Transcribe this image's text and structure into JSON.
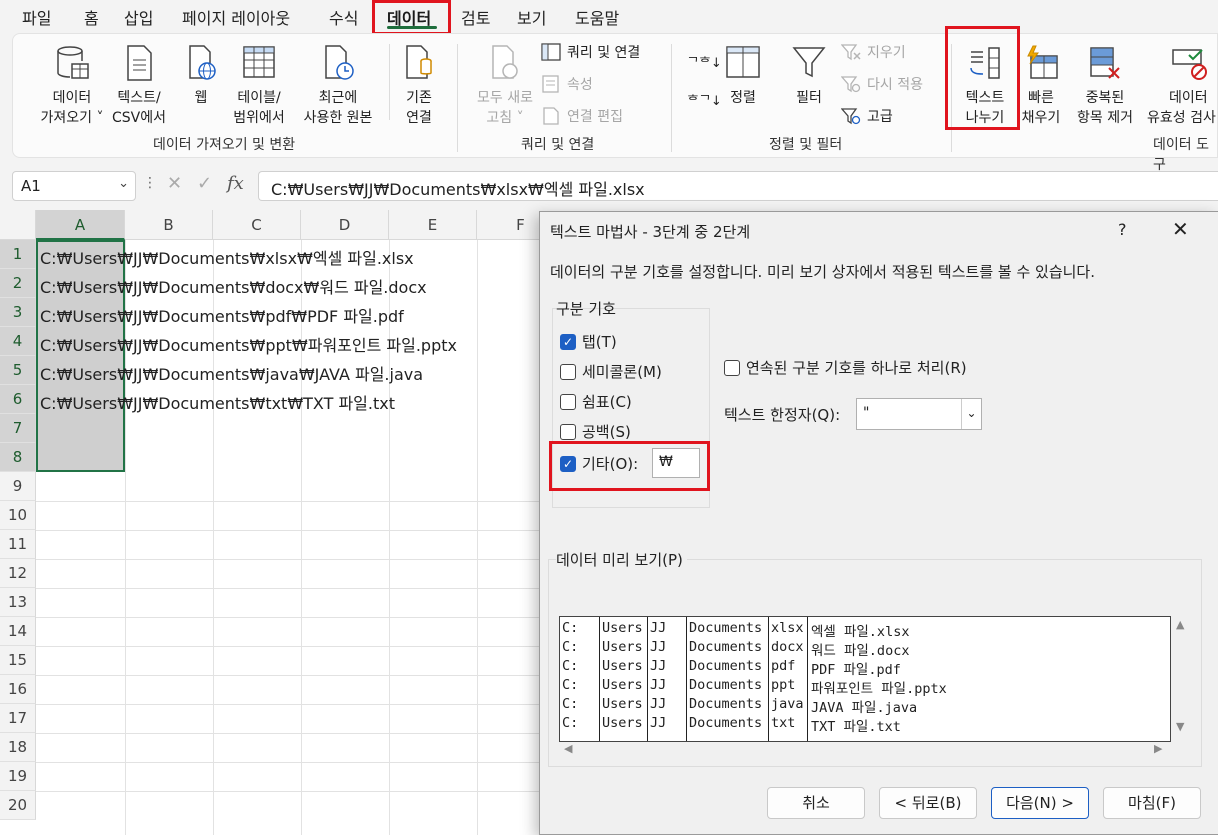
{
  "menu": {
    "tabs": [
      "파일",
      "홈",
      "삽입",
      "페이지 레이아웃",
      "수식",
      "데이터",
      "검토",
      "보기",
      "도움말"
    ],
    "active_tab": "데이터"
  },
  "ribbon": {
    "get_data": {
      "line1": "데이터",
      "line2": "가져오기 ˅"
    },
    "from_text_csv": {
      "line1": "텍스트/",
      "line2": "CSV에서"
    },
    "web": {
      "line1": "웹"
    },
    "table_range": {
      "line1": "테이블/",
      "line2": "범위에서"
    },
    "recent_sources": {
      "line1": "최근에",
      "line2": "사용한 원본"
    },
    "existing_conn": {
      "line1": "기존",
      "line2": "연결"
    },
    "group_get_transform": "데이터 가져오기 및 변환",
    "refresh_all": {
      "line1": "모두 새로",
      "line2": "고침 ˅"
    },
    "queries_connections": "쿼리 및 연결",
    "properties": "속성",
    "edit_links": "연결 편집",
    "group_queries": "쿼리 및 연결",
    "sort": "정렬",
    "filter": "필터",
    "clear": "지우기",
    "reapply": "다시 적용",
    "advanced": "고급",
    "group_sort_filter": "정렬 및 필터",
    "text_to_columns": {
      "line1": "텍스트",
      "line2": "나누기"
    },
    "flash_fill": {
      "line1": "빠른",
      "line2": "채우기"
    },
    "remove_duplicates": {
      "line1": "중복된",
      "line2": "항목 제거"
    },
    "data_validation": {
      "line1": "데이터",
      "line2": "유효성 검사"
    },
    "group_data_tools": "데이터 도구"
  },
  "formula_bar": {
    "name_box": "A1",
    "fx": "fx",
    "formula": "C:₩Users₩JJ₩Documents₩xlsx₩엑셀 파일.xlsx"
  },
  "sheet": {
    "columns": [
      "A",
      "B",
      "C",
      "D",
      "E",
      "F"
    ],
    "rows": [
      "1",
      "2",
      "3",
      "4",
      "5",
      "6",
      "7",
      "8",
      "9",
      "10",
      "11",
      "12",
      "13",
      "14",
      "15",
      "16",
      "17",
      "18",
      "19",
      "20"
    ],
    "cells": [
      "C:₩Users₩JJ₩Documents₩xlsx₩엑셀 파일.xlsx",
      "C:₩Users₩JJ₩Documents₩docx₩워드 파일.docx",
      "C:₩Users₩JJ₩Documents₩pdf₩PDF 파일.pdf",
      "C:₩Users₩JJ₩Documents₩ppt₩파워포인트 파일.pptx",
      "C:₩Users₩JJ₩Documents₩java₩JAVA 파일.java",
      "C:₩Users₩JJ₩Documents₩txt₩TXT 파일.txt"
    ]
  },
  "dialog": {
    "title": "텍스트 마법사 - 3단계 중 2단계",
    "help": "?",
    "close": "✕",
    "description": "데이터의 구분 기호를 설정합니다. 미리 보기 상자에서 적용된 텍스트를 볼 수 있습니다.",
    "delimiters_label": "구분 기호",
    "delimiters": [
      {
        "label": "탭(T)",
        "checked": true
      },
      {
        "label": "세미콜론(M)",
        "checked": false
      },
      {
        "label": "쉼표(C)",
        "checked": false
      },
      {
        "label": "공백(S)",
        "checked": false
      },
      {
        "label": "기타(O):",
        "checked": true
      }
    ],
    "other_value": "₩",
    "consecutive_label": "연속된 구분 기호를 하나로 처리(R)",
    "consecutive_checked": false,
    "qualifier_label": "텍스트 한정자(Q):",
    "qualifier_value": "\"",
    "preview_label": "데이터 미리 보기(P)",
    "preview_rows": [
      [
        "C:",
        "Users",
        "JJ",
        "Documents",
        "xlsx",
        "엑셀 파일.xlsx"
      ],
      [
        "C:",
        "Users",
        "JJ",
        "Documents",
        "docx",
        "워드 파일.docx"
      ],
      [
        "C:",
        "Users",
        "JJ",
        "Documents",
        "pdf",
        "PDF 파일.pdf"
      ],
      [
        "C:",
        "Users",
        "JJ",
        "Documents",
        "ppt",
        "파워포인트 파일.pptx"
      ],
      [
        "C:",
        "Users",
        "JJ",
        "Documents",
        "java",
        "JAVA 파일.java"
      ],
      [
        "C:",
        "Users",
        "JJ",
        "Documents",
        "txt",
        "TXT 파일.txt"
      ]
    ],
    "buttons": {
      "cancel": "취소",
      "back": "< 뒤로(B)",
      "next": "다음(N) >",
      "finish": "마침(F)"
    }
  },
  "colors": {
    "accent": "#217346",
    "highlight": "#e0141e",
    "checkbox": "#1d5fc4"
  }
}
